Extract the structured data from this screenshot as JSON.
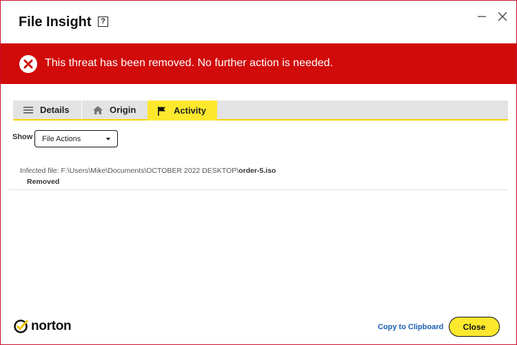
{
  "window": {
    "title": "File Insight",
    "help_label": "?"
  },
  "banner": {
    "message": "This threat has been removed. No further action is needed.",
    "icon": "error-x-icon",
    "color": "#d10a0a"
  },
  "tabs": [
    {
      "label": "Details",
      "icon": "list-icon",
      "active": false
    },
    {
      "label": "Origin",
      "icon": "home-icon",
      "active": false
    },
    {
      "label": "Activity",
      "icon": "flag-icon",
      "active": true
    }
  ],
  "filter": {
    "show_label": "Show",
    "selected": "File Actions"
  },
  "activity": [
    {
      "prefix": "Infected file: ",
      "path": "F:\\Users\\Mike\\Documents\\OCTOBER 2022 DESKTOP\\",
      "filename": "order-5.iso",
      "status": "Removed"
    }
  ],
  "footer": {
    "brand": "norton",
    "copy_label": "Copy to Clipboard",
    "close_label": "Close"
  },
  "colors": {
    "accent_yellow": "#fde82e",
    "alert_red": "#d10a0a",
    "link_blue": "#1a5fb4"
  }
}
